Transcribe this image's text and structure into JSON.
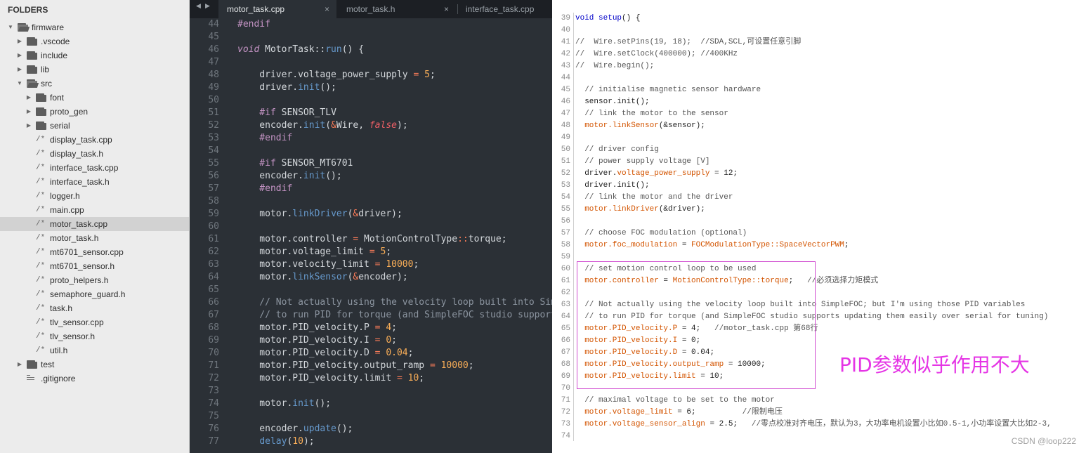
{
  "sidebar": {
    "title": "FOLDERS",
    "items": [
      {
        "label": "firmware",
        "depth": 0,
        "kind": "folder-open"
      },
      {
        "label": ".vscode",
        "depth": 1,
        "kind": "folder"
      },
      {
        "label": "include",
        "depth": 1,
        "kind": "folder"
      },
      {
        "label": "lib",
        "depth": 1,
        "kind": "folder"
      },
      {
        "label": "src",
        "depth": 1,
        "kind": "folder-open"
      },
      {
        "label": "font",
        "depth": 2,
        "kind": "folder"
      },
      {
        "label": "proto_gen",
        "depth": 2,
        "kind": "folder"
      },
      {
        "label": "serial",
        "depth": 2,
        "kind": "folder"
      },
      {
        "label": "display_task.cpp",
        "depth": 2,
        "kind": "file"
      },
      {
        "label": "display_task.h",
        "depth": 2,
        "kind": "file"
      },
      {
        "label": "interface_task.cpp",
        "depth": 2,
        "kind": "file"
      },
      {
        "label": "interface_task.h",
        "depth": 2,
        "kind": "file"
      },
      {
        "label": "logger.h",
        "depth": 2,
        "kind": "file"
      },
      {
        "label": "main.cpp",
        "depth": 2,
        "kind": "file"
      },
      {
        "label": "motor_task.cpp",
        "depth": 2,
        "kind": "file",
        "selected": true
      },
      {
        "label": "motor_task.h",
        "depth": 2,
        "kind": "file"
      },
      {
        "label": "mt6701_sensor.cpp",
        "depth": 2,
        "kind": "file"
      },
      {
        "label": "mt6701_sensor.h",
        "depth": 2,
        "kind": "file"
      },
      {
        "label": "proto_helpers.h",
        "depth": 2,
        "kind": "file"
      },
      {
        "label": "semaphore_guard.h",
        "depth": 2,
        "kind": "file"
      },
      {
        "label": "task.h",
        "depth": 2,
        "kind": "file"
      },
      {
        "label": "tlv_sensor.cpp",
        "depth": 2,
        "kind": "file"
      },
      {
        "label": "tlv_sensor.h",
        "depth": 2,
        "kind": "file"
      },
      {
        "label": "util.h",
        "depth": 2,
        "kind": "file"
      },
      {
        "label": "test",
        "depth": 1,
        "kind": "folder"
      },
      {
        "label": ".gitignore",
        "depth": 1,
        "kind": "text"
      }
    ]
  },
  "editor": {
    "nav_prev": "◀",
    "nav_next": "▶",
    "tabs": [
      {
        "label": "motor_task.cpp",
        "active": true,
        "close": "×"
      },
      {
        "label": "motor_task.h",
        "active": false,
        "close": "×"
      },
      {
        "label": "interface_task.cpp",
        "active": false,
        "close": ""
      }
    ],
    "lines": [
      {
        "n": "44",
        "segs": [
          [
            "pp",
            "#endif"
          ]
        ]
      },
      {
        "n": "45",
        "segs": []
      },
      {
        "n": "46",
        "segs": [
          [
            "kw",
            "void"
          ],
          [
            "",
            " MotorTask::"
          ],
          [
            "fn",
            "run"
          ],
          [
            "",
            "() {"
          ]
        ]
      },
      {
        "n": "47",
        "segs": []
      },
      {
        "n": "48",
        "segs": [
          [
            "",
            "    driver.voltage_power_supply "
          ],
          [
            "op",
            "="
          ],
          [
            "",
            " "
          ],
          [
            "num",
            "5"
          ],
          [
            "",
            ";"
          ]
        ]
      },
      {
        "n": "49",
        "segs": [
          [
            "",
            "    driver."
          ],
          [
            "fn",
            "init"
          ],
          [
            "",
            "();"
          ]
        ]
      },
      {
        "n": "50",
        "segs": []
      },
      {
        "n": "51",
        "segs": [
          [
            "pp",
            "    #if"
          ],
          [
            "",
            " SENSOR_TLV"
          ]
        ]
      },
      {
        "n": "52",
        "segs": [
          [
            "",
            "    encoder."
          ],
          [
            "fn",
            "init"
          ],
          [
            "",
            "("
          ],
          [
            "op",
            "&"
          ],
          [
            "",
            "Wire, "
          ],
          [
            "bool",
            "false"
          ],
          [
            "",
            ");"
          ]
        ]
      },
      {
        "n": "53",
        "segs": [
          [
            "pp",
            "    #endif"
          ]
        ]
      },
      {
        "n": "54",
        "segs": []
      },
      {
        "n": "55",
        "segs": [
          [
            "pp",
            "    #if"
          ],
          [
            "",
            " SENSOR_MT6701"
          ]
        ]
      },
      {
        "n": "56",
        "segs": [
          [
            "",
            "    encoder."
          ],
          [
            "fn",
            "init"
          ],
          [
            "",
            "();"
          ]
        ]
      },
      {
        "n": "57",
        "segs": [
          [
            "pp",
            "    #endif"
          ]
        ]
      },
      {
        "n": "58",
        "segs": []
      },
      {
        "n": "59",
        "segs": [
          [
            "",
            "    motor."
          ],
          [
            "fn",
            "linkDriver"
          ],
          [
            "",
            "("
          ],
          [
            "op",
            "&"
          ],
          [
            "",
            "driver);"
          ]
        ]
      },
      {
        "n": "60",
        "segs": []
      },
      {
        "n": "61",
        "segs": [
          [
            "",
            "    motor.controller "
          ],
          [
            "op",
            "="
          ],
          [
            "",
            " MotionControlType"
          ],
          [
            "op",
            "::"
          ],
          [
            "",
            "torque;"
          ]
        ]
      },
      {
        "n": "62",
        "segs": [
          [
            "",
            "    motor.voltage_limit "
          ],
          [
            "op",
            "="
          ],
          [
            "",
            " "
          ],
          [
            "num",
            "5"
          ],
          [
            "",
            ";"
          ]
        ]
      },
      {
        "n": "63",
        "segs": [
          [
            "",
            "    motor.velocity_limit "
          ],
          [
            "op",
            "="
          ],
          [
            "",
            " "
          ],
          [
            "num",
            "10000"
          ],
          [
            "",
            ";"
          ]
        ]
      },
      {
        "n": "64",
        "segs": [
          [
            "",
            "    motor."
          ],
          [
            "fn",
            "linkSensor"
          ],
          [
            "",
            "("
          ],
          [
            "op",
            "&"
          ],
          [
            "",
            "encoder);"
          ]
        ]
      },
      {
        "n": "65",
        "segs": []
      },
      {
        "n": "66",
        "segs": [
          [
            "cm",
            "    // Not actually using the velocity loop built into SimpleFOC; but I'm using those PID variables"
          ]
        ]
      },
      {
        "n": "67",
        "segs": [
          [
            "cm",
            "    // to run PID for torque (and SimpleFOC studio supports updating them easily over serial for tuning)"
          ]
        ]
      },
      {
        "n": "68",
        "segs": [
          [
            "",
            "    motor.PID_velocity.P "
          ],
          [
            "op",
            "="
          ],
          [
            "",
            " "
          ],
          [
            "num",
            "4"
          ],
          [
            "",
            ";"
          ]
        ]
      },
      {
        "n": "69",
        "segs": [
          [
            "",
            "    motor.PID_velocity.I "
          ],
          [
            "op",
            "="
          ],
          [
            "",
            " "
          ],
          [
            "num",
            "0"
          ],
          [
            "",
            ";"
          ]
        ]
      },
      {
        "n": "70",
        "segs": [
          [
            "",
            "    motor.PID_velocity.D "
          ],
          [
            "op",
            "="
          ],
          [
            "",
            " "
          ],
          [
            "num",
            "0.04"
          ],
          [
            "",
            ";"
          ]
        ]
      },
      {
        "n": "71",
        "segs": [
          [
            "",
            "    motor.PID_velocity.output_ramp "
          ],
          [
            "op",
            "="
          ],
          [
            "",
            " "
          ],
          [
            "num",
            "10000"
          ],
          [
            "",
            ";"
          ]
        ]
      },
      {
        "n": "72",
        "segs": [
          [
            "",
            "    motor.PID_velocity.limit "
          ],
          [
            "op",
            "="
          ],
          [
            "",
            " "
          ],
          [
            "num",
            "10"
          ],
          [
            "",
            ";"
          ]
        ]
      },
      {
        "n": "73",
        "segs": []
      },
      {
        "n": "74",
        "segs": [
          [
            "",
            "    motor."
          ],
          [
            "fn",
            "init"
          ],
          [
            "",
            "();"
          ]
        ]
      },
      {
        "n": "75",
        "segs": []
      },
      {
        "n": "76",
        "segs": [
          [
            "",
            "    encoder."
          ],
          [
            "fn",
            "update"
          ],
          [
            "",
            "();"
          ]
        ]
      },
      {
        "n": "77",
        "segs": [
          [
            "",
            "    "
          ],
          [
            "fn",
            "delay"
          ],
          [
            "",
            "("
          ],
          [
            "num",
            "10"
          ],
          [
            "",
            ");"
          ]
        ]
      }
    ]
  },
  "right": {
    "lines": [
      {
        "n": "39",
        "segs": [
          [
            "kw",
            "void"
          ],
          [
            "",
            " "
          ],
          [
            "kw",
            "setup"
          ],
          [
            "",
            "() {"
          ]
        ]
      },
      {
        "n": "40",
        "segs": []
      },
      {
        "n": "41",
        "segs": [
          [
            "cm",
            "//  Wire.setPins(19, 18);  //SDA,SCL,可设置任意引脚"
          ]
        ]
      },
      {
        "n": "42",
        "segs": [
          [
            "cm",
            "//  Wire.setClock(400000); //400KHz"
          ]
        ]
      },
      {
        "n": "43",
        "segs": [
          [
            "cm",
            "//  Wire.begin();"
          ]
        ]
      },
      {
        "n": "44",
        "segs": []
      },
      {
        "n": "45",
        "segs": [
          [
            "cm",
            "  // initialise magnetic sensor hardware"
          ]
        ]
      },
      {
        "n": "46",
        "segs": [
          [
            "",
            "  sensor.init();"
          ]
        ]
      },
      {
        "n": "47",
        "segs": [
          [
            "cm",
            "  // link the motor to the sensor"
          ]
        ]
      },
      {
        "n": "48",
        "segs": [
          [
            "orange",
            "  motor.linkSensor"
          ],
          [
            "",
            "(&sensor);"
          ]
        ]
      },
      {
        "n": "49",
        "segs": []
      },
      {
        "n": "50",
        "segs": [
          [
            "cm",
            "  // driver config"
          ]
        ]
      },
      {
        "n": "51",
        "segs": [
          [
            "cm",
            "  // power supply voltage [V]"
          ]
        ]
      },
      {
        "n": "52",
        "segs": [
          [
            "",
            "  driver."
          ],
          [
            "orange",
            "voltage_power_supply"
          ],
          [
            "",
            " = 12;"
          ]
        ]
      },
      {
        "n": "53",
        "segs": [
          [
            "",
            "  driver.init();"
          ]
        ]
      },
      {
        "n": "54",
        "segs": [
          [
            "cm",
            "  // link the motor and the driver"
          ]
        ]
      },
      {
        "n": "55",
        "segs": [
          [
            "orange",
            "  motor.linkDriver"
          ],
          [
            "",
            "(&driver);"
          ]
        ]
      },
      {
        "n": "56",
        "segs": []
      },
      {
        "n": "57",
        "segs": [
          [
            "cm",
            "  // choose FOC modulation (optional)"
          ]
        ]
      },
      {
        "n": "58",
        "segs": [
          [
            "orange",
            "  motor.foc_modulation"
          ],
          [
            "",
            " = "
          ],
          [
            "orange",
            "FOCModulationType::SpaceVectorPWM"
          ],
          [
            "",
            ";"
          ]
        ]
      },
      {
        "n": "59",
        "segs": []
      },
      {
        "n": "60",
        "segs": [
          [
            "cm",
            "  // set motion control loop to be used"
          ]
        ]
      },
      {
        "n": "61",
        "segs": [
          [
            "orange",
            "  motor.controller"
          ],
          [
            "",
            " = "
          ],
          [
            "orange",
            "MotionControlType::torque"
          ],
          [
            "",
            ";   "
          ],
          [
            "cm",
            "//必须选择力矩模式"
          ]
        ]
      },
      {
        "n": "62",
        "segs": []
      },
      {
        "n": "63",
        "segs": [
          [
            "cm",
            "  // Not actually using the velocity loop built into SimpleFOC; but I'm using those PID variables"
          ]
        ]
      },
      {
        "n": "64",
        "segs": [
          [
            "cm",
            "  // to run PID for torque (and SimpleFOC studio supports updating them easily over serial for tuning)"
          ]
        ]
      },
      {
        "n": "65",
        "segs": [
          [
            "orange",
            "  motor.PID_velocity.P"
          ],
          [
            "",
            " = 4;   "
          ],
          [
            "cm",
            "//motor_task.cpp 第68行"
          ]
        ]
      },
      {
        "n": "66",
        "segs": [
          [
            "orange",
            "  motor.PID_velocity.I"
          ],
          [
            "",
            " = 0;"
          ]
        ]
      },
      {
        "n": "67",
        "segs": [
          [
            "orange",
            "  motor.PID_velocity.D"
          ],
          [
            "",
            " = 0.04;"
          ]
        ]
      },
      {
        "n": "68",
        "segs": [
          [
            "orange",
            "  motor.PID_velocity.output_ramp"
          ],
          [
            "",
            " = 10000;"
          ]
        ]
      },
      {
        "n": "69",
        "segs": [
          [
            "orange",
            "  motor.PID_velocity.limit"
          ],
          [
            "",
            " = 10;"
          ]
        ]
      },
      {
        "n": "70",
        "segs": []
      },
      {
        "n": "71",
        "segs": [
          [
            "cm",
            "  // maximal voltage to be set to the motor"
          ]
        ]
      },
      {
        "n": "72",
        "segs": [
          [
            "orange",
            "  motor.voltage_limit"
          ],
          [
            "",
            " = 6;          "
          ],
          [
            "cm",
            "//限制电压"
          ]
        ]
      },
      {
        "n": "73",
        "segs": [
          [
            "orange",
            "  motor.voltage_sensor_align"
          ],
          [
            "",
            " = 2.5;   "
          ],
          [
            "cm",
            "//零点校准对齐电压，默认为3，大功率电机设置小比如0.5-1,小功率设置大比如2-3,"
          ]
        ]
      },
      {
        "n": "74",
        "segs": []
      }
    ],
    "annotation": "PID参数似乎作用不大",
    "watermark": "CSDN @loop222",
    "annotation_color": "#e535e5"
  }
}
